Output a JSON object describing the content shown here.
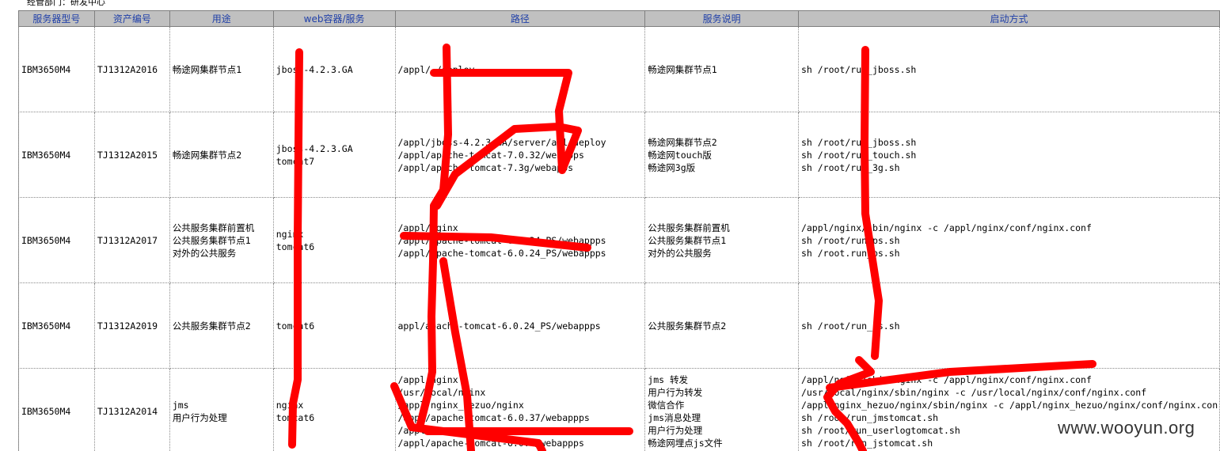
{
  "department_line": "经管部门：研发中心",
  "headers": [
    "服务器型号",
    "资产编号",
    "用途",
    "web容器/服务",
    "路径",
    "服务说明",
    "启动方式"
  ],
  "rows": [
    {
      "model": "IBM3650M4",
      "asset": "TJ1312A2016",
      "purpose": [
        "畅途网集群节点1"
      ],
      "container": [
        "jboss-4.2.3.GA"
      ],
      "path": [
        "/appl/                              /deploy"
      ],
      "description": [
        "畅途网集群节点1"
      ],
      "startup": [
        "sh /root/run_jboss.sh"
      ]
    },
    {
      "model": "IBM3650M4",
      "asset": "TJ1312A2015",
      "purpose": [
        "畅途网集群节点2"
      ],
      "container": [
        "jboss-4.2.3.GA",
        "tomcat7"
      ],
      "path": [
        "/appl/jboss-4.2.3.GA/server/all/deploy",
        "/appl/apache-tomcat-7.0.32/webapps",
        "/appl/apache-tomcat-7.3g/webapps"
      ],
      "description": [
        "畅途网集群节点2",
        "畅途网touch版",
        "畅途网3g版"
      ],
      "startup": [
        "sh /root/run_jboss.sh",
        "sh /root/run_touch.sh",
        "sh /root/run_3g.sh"
      ]
    },
    {
      "model": "IBM3650M4",
      "asset": "TJ1312A2017",
      "purpose": [
        "公共服务集群前置机",
        "公共服务集群节点1",
        "对外的公共服务"
      ],
      "container": [
        "nginx",
        "tomcat6"
      ],
      "path": [
        "/appl/nginx",
        "/appl/apache-tomcat-6.0.24_PS/webappps",
        "/appl/apache-tomcat-6.0.24_PS/webappps"
      ],
      "description": [
        "公共服务集群前置机",
        "公共服务集群节点1",
        "对外的公共服务"
      ],
      "startup": [
        "/appl/nginx/sbin/nginx -c /appl/nginx/conf/nginx.conf",
        "sh /root/run_ps.sh",
        "sh /root.run_ps.sh"
      ]
    },
    {
      "model": "IBM3650M4",
      "asset": "TJ1312A2019",
      "purpose": [
        "公共服务集群节点2"
      ],
      "container": [
        "tomcat6"
      ],
      "path": [
        "appl/apache-tomcat-6.0.24_PS/webappps"
      ],
      "description": [
        "公共服务集群节点2"
      ],
      "startup": [
        "sh /root/run_ps.sh"
      ]
    },
    {
      "model": "IBM3650M4",
      "asset": "TJ1312A2014",
      "purpose": [
        "jms",
        "用户行为处理"
      ],
      "container": [
        "nginx",
        "tomcat6"
      ],
      "path": [
        "/appl/nginx",
        "/usr/local/nginx",
        "/appl/nginx_hezuo/nginx",
        "/appl/apache-tomcat-6.0.37/webappps",
        "/appl/",
        "/appl/apache-tomcat-6.0.  /webappps"
      ],
      "description": [
        "jms 转发",
        "用户行为转发",
        "微信合作",
        "jms消息处理",
        "用户行为处理",
        "畅途网埋点js文件"
      ],
      "startup": [
        "/appl/nginx/sbin/nginx -c /appl/nginx/conf/nginx.conf",
        "/usr/local/nginx/sbin/nginx -c /usr/local/nginx/conf/nginx.conf",
        "/appl/nginx_hezuo/nginx/sbin/nginx -c /appl/nginx_hezuo/nginx/conf/nginx.con",
        "sh /root/run_jmstomcat.sh",
        "sh /root/run_userlogtomcat.sh",
        "sh /root/run_jstomcat.sh"
      ]
    }
  ],
  "watermark": "www.wooyun.org",
  "colors": {
    "header_bg": "#c0c0c0",
    "header_text": "#1f3fa8",
    "redaction": "#ff0000"
  }
}
